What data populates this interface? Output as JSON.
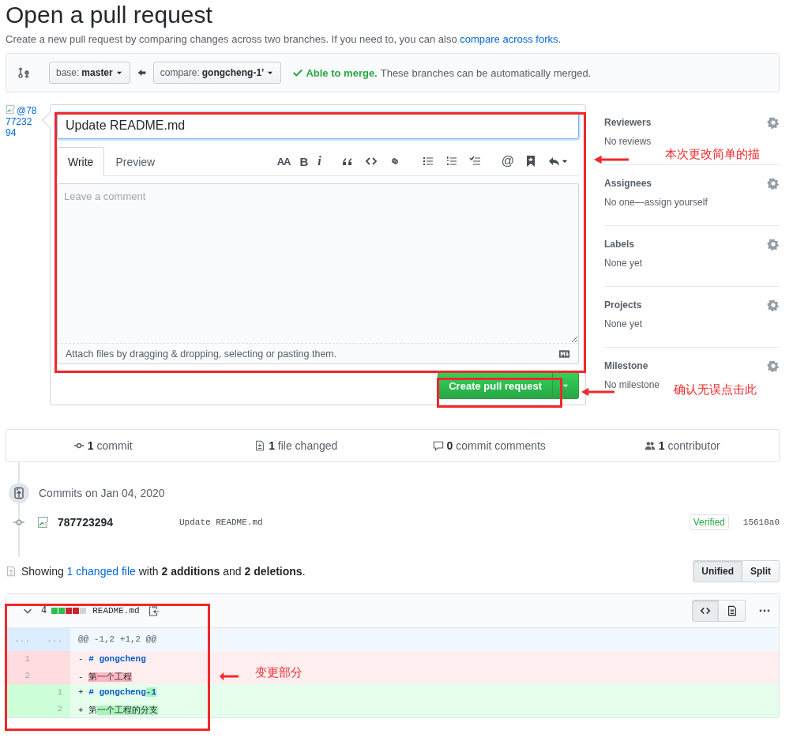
{
  "page": {
    "title": "Open a pull request",
    "description": {
      "before": "Create a new pull request by comparing changes across two branches. If you need to, you can also",
      "link": "compare across forks",
      "after": "."
    }
  },
  "range": {
    "base_label": "base:",
    "base": "master",
    "compare_label": "compare:",
    "compare": "gongcheng-1’",
    "merge": {
      "ok": true,
      "title": "Able to merge.",
      "message": "These branches can be automatically merged."
    }
  },
  "avatar": {
    "alt": "@787723294"
  },
  "composer": {
    "title_value": "Update README.md",
    "tabs": [
      {
        "label": "Write",
        "selected": true
      },
      {
        "label": "Preview",
        "selected": false
      }
    ],
    "toolbar": [
      {
        "kind": "heading",
        "label": "AA"
      },
      {
        "kind": "bold",
        "label": "B"
      },
      {
        "kind": "italic",
        "label": "i"
      },
      {
        "kind": "gap"
      },
      {
        "kind": "quote"
      },
      {
        "kind": "code"
      },
      {
        "kind": "link"
      },
      {
        "kind": "gap"
      },
      {
        "kind": "ul"
      },
      {
        "kind": "ol"
      },
      {
        "kind": "tasklist"
      },
      {
        "kind": "gap"
      },
      {
        "kind": "mention",
        "label": "@"
      },
      {
        "kind": "bookmark"
      },
      {
        "kind": "reply"
      }
    ],
    "placeholder": "Leave a comment",
    "attach_text": "Attach files by dragging & dropping, selecting or pasting them.",
    "submit": "Create pull request"
  },
  "sidebar": {
    "sections": [
      {
        "title": "Reviewers",
        "value": "No reviews"
      },
      {
        "title": "Assignees",
        "value": "No one—assign yourself"
      },
      {
        "title": "Labels",
        "value": "None yet"
      },
      {
        "title": "Projects",
        "value": "None yet"
      },
      {
        "title": "Milestone",
        "value": "No milestone"
      }
    ]
  },
  "stats": [
    {
      "kind": "commit",
      "count": "1",
      "label": "commit"
    },
    {
      "kind": "file",
      "count": "1",
      "label": "file changed"
    },
    {
      "kind": "comment",
      "count": "0",
      "label": "commit comments"
    },
    {
      "kind": "people",
      "count": "1",
      "label": "contributor"
    }
  ],
  "commits": {
    "heading": "Commits on Jan 04, 2020",
    "items": [
      {
        "author": "787723294",
        "message": "Update README.md",
        "badge": "Verified",
        "sha": "15618a0"
      }
    ]
  },
  "summary": {
    "before": "Showing",
    "link": "1 changed file",
    "after": "with **2 additions** and **2 deletions**."
  },
  "view_toggle": [
    {
      "label": "Unified",
      "selected": true
    },
    {
      "label": "Split",
      "selected": false
    }
  ],
  "file": {
    "expanded": true,
    "changes": "4",
    "diffstat": [
      {
        "color": "#2cbe4e"
      },
      {
        "color": "#2cbe4e"
      },
      {
        "color": "#cb2431"
      },
      {
        "color": "#cb2431"
      },
      {
        "color": "#d1d5da"
      }
    ],
    "name": "README.md",
    "view_modes": [
      {
        "kind": "source",
        "selected": true
      },
      {
        "kind": "rich",
        "selected": false
      }
    ],
    "hunk": {
      "old": "...",
      "new": "...",
      "text": "@@ -1,2 +1,2 @@"
    },
    "lines": [
      {
        "kind": "del",
        "old": "1",
        "prefix": "-",
        "segments": [
          {
            "text": "# gongcheng",
            "heading": true,
            "highlight": false
          }
        ]
      },
      {
        "kind": "del",
        "old": "2",
        "prefix": "-",
        "segments": [
          {
            "text": "第一个工程",
            "heading": false,
            "highlight": true
          }
        ]
      },
      {
        "kind": "add",
        "new": "1",
        "prefix": "+",
        "segments": [
          {
            "text": "# gongcheng",
            "heading": true,
            "highlight": false
          },
          {
            "text": "-1",
            "heading": true,
            "highlight": true
          }
        ]
      },
      {
        "kind": "add",
        "new": "2",
        "prefix": "+",
        "segments": [
          {
            "text": "第",
            "heading": false,
            "highlight": false
          },
          {
            "text": "一个工程的分支",
            "heading": false,
            "highlight": true
          }
        ]
      }
    ]
  },
  "annotations": [
    {
      "text": "本次更改简单的描"
    },
    {
      "text": "确认无误点击此"
    },
    {
      "text": "变更部分"
    }
  ]
}
